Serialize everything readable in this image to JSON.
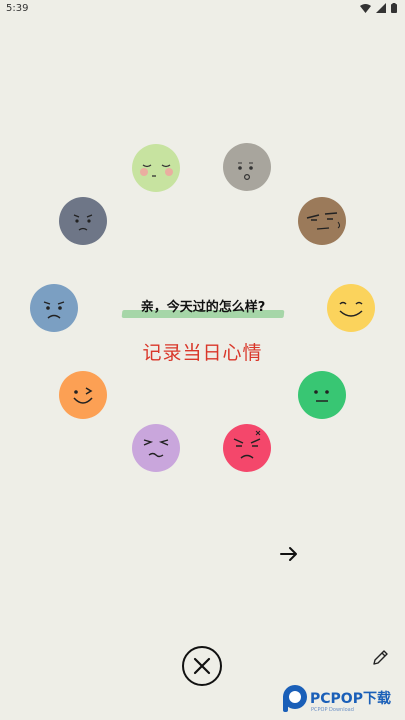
{
  "status": {
    "time": "5:39"
  },
  "prompt": {
    "question": "亲，今天过的怎么样?"
  },
  "title": {
    "record": "记录当日心情"
  },
  "moods": [
    {
      "name": "sleepy",
      "color": "#c7e3a0"
    },
    {
      "name": "surprised",
      "color": "#a8a59d"
    },
    {
      "name": "annoyed",
      "color": "#9b7a5a"
    },
    {
      "name": "happy",
      "color": "#fbd35c"
    },
    {
      "name": "calm",
      "color": "#38c673"
    },
    {
      "name": "angry",
      "color": "#f4476b"
    },
    {
      "name": "worried",
      "color": "#c9a6dc"
    },
    {
      "name": "playful",
      "color": "#fca054"
    },
    {
      "name": "sad",
      "color": "#7b9fc2"
    },
    {
      "name": "gloomy",
      "color": "#6e7687"
    }
  ],
  "watermark": {
    "brand": "PCPOP下载",
    "sub": "PCPOP Download"
  },
  "icons": {
    "next": "arrow-right-icon",
    "close": "close-circle-icon",
    "edit": "pencil-icon"
  }
}
